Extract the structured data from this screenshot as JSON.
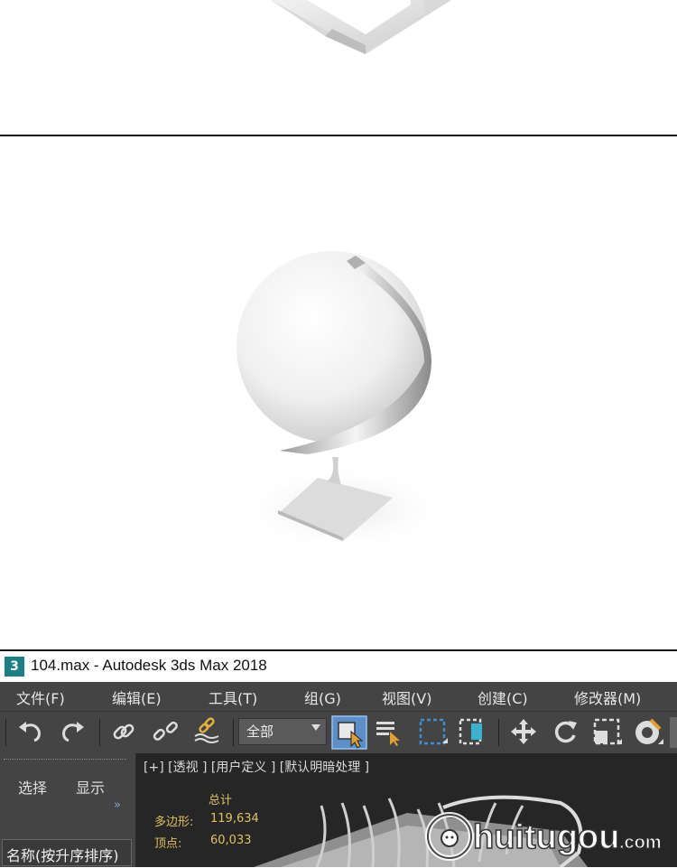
{
  "window": {
    "title": "104.max - Autodesk 3ds Max 2018",
    "app_icon_label": "3"
  },
  "menu": {
    "items": [
      "文件(F)",
      "编辑(E)",
      "工具(T)",
      "组(G)",
      "视图(V)",
      "创建(C)",
      "修改器(M)"
    ]
  },
  "toolbar": {
    "selection_filter": "全部",
    "icons": [
      "undo-icon",
      "redo-icon",
      "link-icon",
      "unlink-icon",
      "bind-space-warp-icon",
      "select-object-icon",
      "select-by-name-icon",
      "rect-region-icon",
      "window-crossing-icon",
      "move-icon",
      "rotate-icon",
      "scale-icon",
      "snap-icon"
    ]
  },
  "scene_explorer": {
    "tabs": [
      "选择",
      "显示"
    ],
    "column_header": "名称(按升序排序)"
  },
  "viewport": {
    "label": "[+] [透视 ] [用户定义 ] [默认明暗处理 ]",
    "stats": {
      "header": "总计",
      "polygons_label": "多边形:",
      "polygons_value": "119,634",
      "vertices_label": "顶点:",
      "vertices_value": "60,033"
    }
  },
  "watermark": {
    "text": "huitugou",
    "suffix": ".com"
  },
  "colors": {
    "ui_background": "#444444",
    "viewport_background": "#262626",
    "accent_blue": "#3d8fd6",
    "stats_yellow": "#e0c060"
  }
}
